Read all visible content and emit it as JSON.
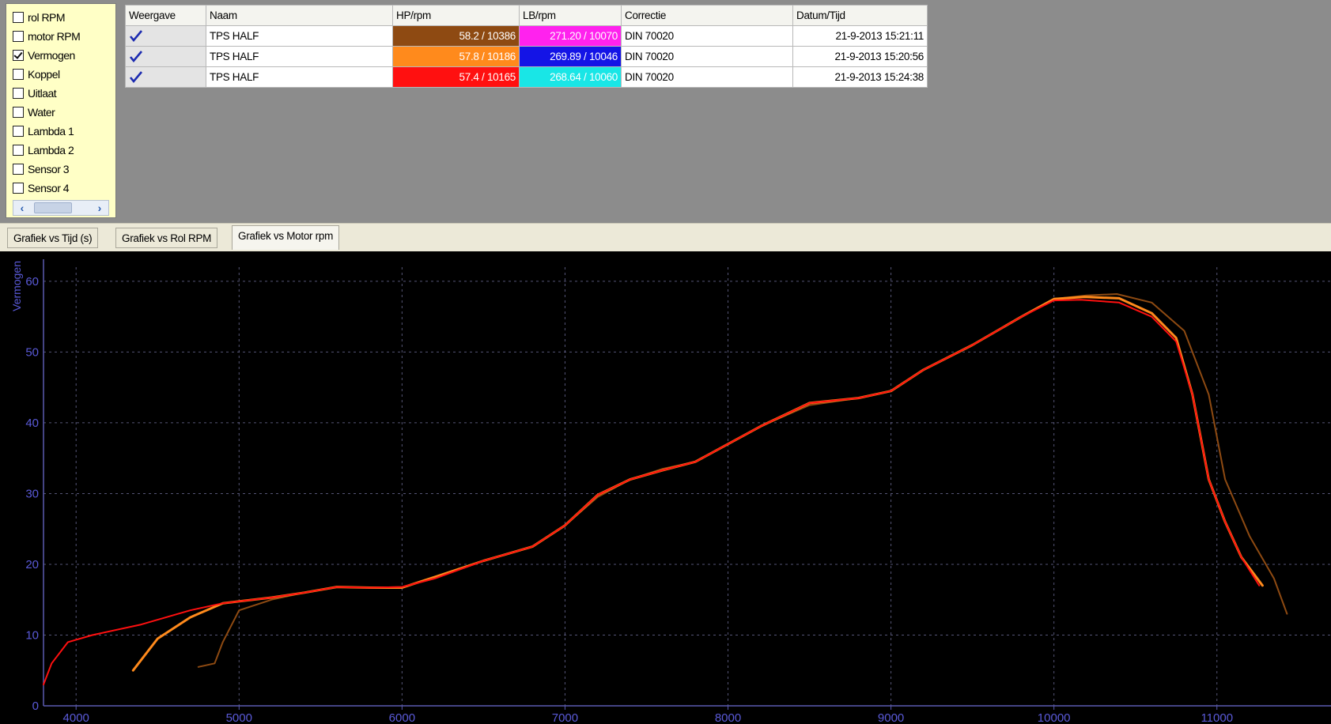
{
  "channels": [
    {
      "label": "rol RPM",
      "checked": false
    },
    {
      "label": "motor RPM",
      "checked": false
    },
    {
      "label": "Vermogen",
      "checked": true
    },
    {
      "label": "Koppel",
      "checked": false
    },
    {
      "label": "Uitlaat",
      "checked": false
    },
    {
      "label": "Water",
      "checked": false
    },
    {
      "label": "Lambda 1",
      "checked": false
    },
    {
      "label": "Lambda 2",
      "checked": false
    },
    {
      "label": "Sensor 3",
      "checked": false
    },
    {
      "label": "Sensor 4",
      "checked": false
    }
  ],
  "table": {
    "headers": [
      "Weergave",
      "Naam",
      "HP/rpm",
      "LB/rpm",
      "Correctie",
      "Datum/Tijd"
    ],
    "rows": [
      {
        "shown": true,
        "name": "TPS HALF",
        "hp": "58.2 / 10386",
        "hp_color": "#8e4a12",
        "lb": "271.20 / 10070",
        "lb_color": "#ff22ee",
        "correction": "DIN 70020",
        "datetime": "21-9-2013 15:21:11"
      },
      {
        "shown": true,
        "name": "TPS HALF",
        "hp": "57.8 / 10186",
        "hp_color": "#ff8a1c",
        "lb": "269.89 / 10046",
        "lb_color": "#1414e6",
        "correction": "DIN 70020",
        "datetime": "21-9-2013 15:20:56"
      },
      {
        "shown": true,
        "name": "TPS HALF",
        "hp": "57.4 / 10165",
        "hp_color": "#ff1010",
        "lb": "268.64 / 10060",
        "lb_color": "#19e6e6",
        "correction": "DIN 70020",
        "datetime": "21-9-2013 15:24:38"
      }
    ]
  },
  "tabs": [
    {
      "label": "Grafiek vs Tijd (s)",
      "active": false
    },
    {
      "label": "Grafiek vs Rol RPM",
      "active": false
    },
    {
      "label": "Grafiek vs Motor rpm",
      "active": true
    }
  ],
  "chart_data": {
    "type": "line",
    "ylabel": "Vermogen",
    "xlabel": "",
    "xlim": [
      3800,
      11700
    ],
    "ylim": [
      0,
      62
    ],
    "xticks": [
      4000,
      5000,
      6000,
      7000,
      8000,
      9000,
      10000,
      11000
    ],
    "yticks": [
      0,
      10,
      20,
      30,
      40,
      50,
      60
    ],
    "grid": true,
    "series": [
      {
        "color": "#8e4a12",
        "points": [
          [
            4750,
            5.5
          ],
          [
            4850,
            6
          ],
          [
            4900,
            9
          ],
          [
            5000,
            13.5
          ],
          [
            5200,
            15
          ],
          [
            5400,
            16
          ],
          [
            5600,
            16.8
          ],
          [
            5800,
            16.7
          ],
          [
            6000,
            16.8
          ],
          [
            6200,
            18
          ],
          [
            6500,
            20.5
          ],
          [
            6800,
            22.5
          ],
          [
            7000,
            25.5
          ],
          [
            7200,
            29.5
          ],
          [
            7400,
            32
          ],
          [
            7600,
            33.5
          ],
          [
            7800,
            34.5
          ],
          [
            8000,
            37
          ],
          [
            8200,
            39.5
          ],
          [
            8500,
            42.5
          ],
          [
            8800,
            43.5
          ],
          [
            9000,
            44.5
          ],
          [
            9200,
            47.5
          ],
          [
            9500,
            51
          ],
          [
            9800,
            55
          ],
          [
            10000,
            57.5
          ],
          [
            10200,
            58
          ],
          [
            10386,
            58.2
          ],
          [
            10600,
            57
          ],
          [
            10800,
            53
          ],
          [
            10950,
            44
          ],
          [
            11050,
            32
          ],
          [
            11200,
            24
          ],
          [
            11350,
            18
          ],
          [
            11430,
            13
          ]
        ]
      },
      {
        "color": "#ff8a1c",
        "points": [
          [
            4350,
            5
          ],
          [
            4500,
            9.5
          ],
          [
            4700,
            12.5
          ],
          [
            4900,
            14.5
          ],
          [
            5200,
            15.3
          ],
          [
            5400,
            16
          ],
          [
            5600,
            16.8
          ],
          [
            5800,
            16.7
          ],
          [
            6000,
            16.7
          ],
          [
            6200,
            18.2
          ],
          [
            6500,
            20.5
          ],
          [
            6800,
            22.5
          ],
          [
            7000,
            25.5
          ],
          [
            7200,
            29.8
          ],
          [
            7400,
            32
          ],
          [
            7600,
            33.3
          ],
          [
            7800,
            34.5
          ],
          [
            8000,
            37
          ],
          [
            8200,
            39.5
          ],
          [
            8500,
            42.8
          ],
          [
            8800,
            43.5
          ],
          [
            9000,
            44.5
          ],
          [
            9200,
            47.5
          ],
          [
            9500,
            51
          ],
          [
            9800,
            55
          ],
          [
            10000,
            57.5
          ],
          [
            10186,
            57.8
          ],
          [
            10400,
            57.6
          ],
          [
            10600,
            55.5
          ],
          [
            10750,
            52
          ],
          [
            10850,
            44
          ],
          [
            10950,
            32
          ],
          [
            11050,
            26
          ],
          [
            11150,
            21
          ],
          [
            11280,
            17
          ]
        ]
      },
      {
        "color": "#ff1010",
        "points": [
          [
            3800,
            3
          ],
          [
            3850,
            6
          ],
          [
            3950,
            9
          ],
          [
            4100,
            10
          ],
          [
            4400,
            11.5
          ],
          [
            4700,
            13.5
          ],
          [
            4900,
            14.5
          ],
          [
            5200,
            15.3
          ],
          [
            5400,
            16
          ],
          [
            5600,
            16.8
          ],
          [
            5800,
            16.7
          ],
          [
            6000,
            16.8
          ],
          [
            6200,
            18
          ],
          [
            6500,
            20.5
          ],
          [
            6800,
            22.5
          ],
          [
            7000,
            25.5
          ],
          [
            7200,
            29.8
          ],
          [
            7400,
            32
          ],
          [
            7600,
            33.3
          ],
          [
            7800,
            34.5
          ],
          [
            8000,
            37
          ],
          [
            8200,
            39.5
          ],
          [
            8500,
            42.8
          ],
          [
            8800,
            43.5
          ],
          [
            9000,
            44.5
          ],
          [
            9200,
            47.5
          ],
          [
            9500,
            51
          ],
          [
            9800,
            55
          ],
          [
            10000,
            57.3
          ],
          [
            10165,
            57.4
          ],
          [
            10400,
            57
          ],
          [
            10600,
            55
          ],
          [
            10750,
            51.5
          ],
          [
            10850,
            44
          ],
          [
            10950,
            32
          ],
          [
            11050,
            26
          ],
          [
            11150,
            21
          ],
          [
            11260,
            17
          ]
        ]
      }
    ]
  }
}
